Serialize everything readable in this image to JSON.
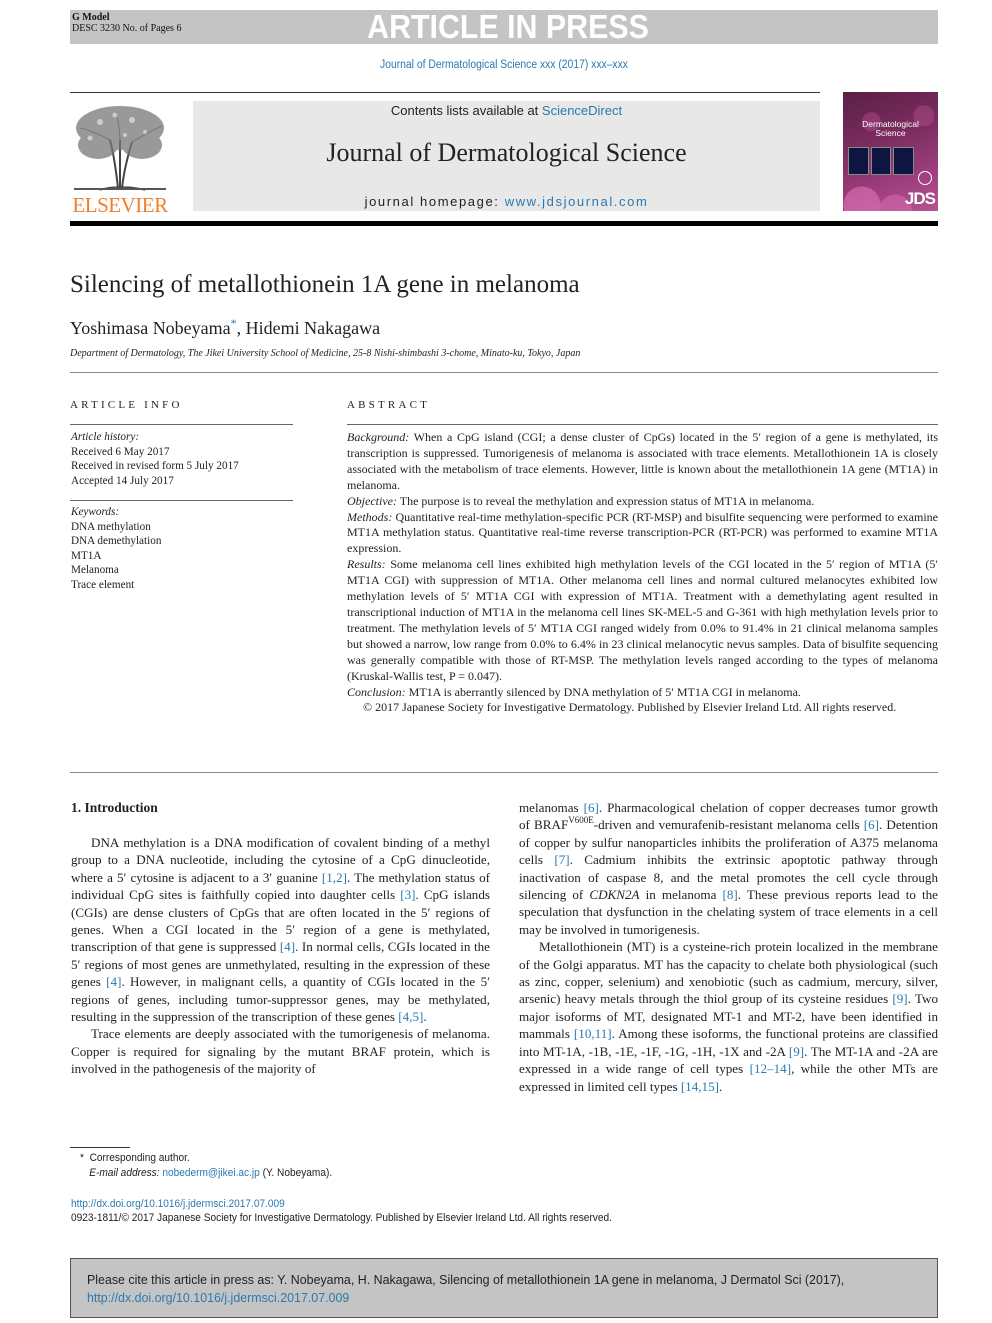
{
  "banner": {
    "g_model": "G Model",
    "doc_id": "DESC 3230 No. of Pages 6",
    "status": "ARTICLE IN PRESS",
    "journal_ref": "Journal of Dermatological Science xxx (2017) xxx–xxx"
  },
  "header": {
    "publisher": "ELSEVIER",
    "contents_prefix": "Contents lists available at ",
    "contents_link": "ScienceDirect",
    "journal_name": "Journal of Dermatological Science",
    "homepage_prefix": "journal homepage: ",
    "homepage_link": "www.jdsjournal.com",
    "cover_title_line1": "Dermatological",
    "cover_title_line2": "Science",
    "cover_badge": "JDS"
  },
  "article": {
    "title": "Silencing of metallothionein 1A gene in melanoma",
    "author1": "Yoshimasa Nobeyama",
    "author_marker": "*",
    "author_sep": ", ",
    "author2": "Hidemi Nakagawa",
    "affiliation": "Department of Dermatology, The Jikei University School of Medicine, 25-8 Nishi-shimbashi 3-chome, Minato-ku, Tokyo, Japan"
  },
  "article_info": {
    "heading": "ARTICLE INFO",
    "history_label": "Article history:",
    "history": [
      "Received 6 May 2017",
      "Received in revised form 5 July 2017",
      "Accepted 14 July 2017"
    ],
    "keywords_label": "Keywords:",
    "keywords": [
      "DNA methylation",
      "DNA demethylation",
      "MT1A",
      "Melanoma",
      "Trace element"
    ]
  },
  "abstract": {
    "heading": "ABSTRACT",
    "background_label": "Background:",
    "background_text": " When a CpG island (CGI; a dense cluster of CpGs) located in the 5′ region of a gene is methylated, its transcription is suppressed. Tumorigenesis of melanoma is associated with trace elements. Metallothionein 1A is closely associated with the metabolism of trace elements. However, little is known about the metallothionein 1A gene (MT1A) in melanoma.",
    "objective_label": "Objective:",
    "objective_text": " The purpose is to reveal the methylation and expression status of MT1A in melanoma.",
    "methods_label": "Methods:",
    "methods_text": " Quantitative real-time methylation-specific PCR (RT-MSP) and bisulfite sequencing were performed to examine MT1A methylation status. Quantitative real-time reverse transcription-PCR (RT-PCR) was performed to examine MT1A expression.",
    "results_label": "Results:",
    "results_text": " Some melanoma cell lines exhibited high methylation levels of the CGI located in the 5′ region of MT1A (5′ MT1A CGI) with suppression of MT1A. Other melanoma cell lines and normal cultured melanocytes exhibited low methylation levels of 5′ MT1A CGI with expression of MT1A. Treatment with a demethylating agent resulted in transcriptional induction of MT1A in the melanoma cell lines SK-MEL-5 and G-361 with high methylation levels prior to treatment. The methylation levels of 5′ MT1A CGI ranged widely from 0.0% to 91.4% in 21 clinical melanoma samples but showed a narrow, low range from 0.0% to 6.4% in 23 clinical melanocytic nevus samples. Data of bisulfite sequencing was generally compatible with those of RT-MSP. The methylation levels ranged according to the types of melanoma (Kruskal-Wallis test, P = 0.047).",
    "conclusion_label": "Conclusion:",
    "conclusion_text": " MT1A is aberrantly silenced by DNA methylation of 5′ MT1A CGI in melanoma.",
    "copyright": "© 2017 Japanese Society for Investigative Dermatology. Published by Elsevier Ireland Ltd. All rights reserved."
  },
  "body": {
    "section_heading": "1. Introduction",
    "left": {
      "p1_a": "DNA methylation is a DNA modification of covalent binding of a methyl group to a DNA nucleotide, including the cytosine of a CpG dinucleotide, where a 5′ cytosine is adjacent to a 3′ guanine ",
      "p1_ref1": "[1,2]",
      "p1_b": ". The methylation status of individual CpG sites is faithfully copied into daughter cells ",
      "p1_ref2": "[3]",
      "p1_c": ". CpG islands (CGIs) are dense clusters of CpGs that are often located in the 5′ regions of genes. When a CGI located in the 5′ region of a gene is methylated, transcription of that gene is suppressed ",
      "p1_ref3": "[4]",
      "p1_d": ". In normal cells, CGIs located in the 5′ regions of most genes are unmethylated, resulting in the expression of these genes ",
      "p1_ref4": "[4]",
      "p1_e": ". However, in malignant cells, a quantity of CGIs located in the 5′ regions of genes, including tumor-suppressor genes, may be methylated, resulting in the suppression of the transcription of these genes ",
      "p1_ref5": "[4,5]",
      "p1_f": ".",
      "p2": "Trace elements are deeply associated with the tumorigenesis of melanoma. Copper is required for signaling by the mutant BRAF protein, which is involved in the pathogenesis of the majority of"
    },
    "right": {
      "p2_a": "melanomas ",
      "p2_ref1": "[6]",
      "p2_b": ". Pharmacological chelation of copper decreases tumor growth of BRAF",
      "p2_sup": "V600E",
      "p2_c": "-driven and vemurafenib-resistant melanoma cells ",
      "p2_ref2": "[6]",
      "p2_d": ". Detention of copper by sulfur nanoparticles inhibits the proliferation of A375 melanoma cells ",
      "p2_ref3": "[7]",
      "p2_e": ". Cadmium inhibits the extrinsic apoptotic pathway through inactivation of caspase 8, and the metal promotes the cell cycle through silencing of ",
      "p2_gene": "CDKN2A",
      "p2_f": " in melanoma ",
      "p2_ref4": "[8]",
      "p2_g": ". These previous reports lead to the speculation that dysfunction in the chelating system of trace elements in a cell may be involved in tumorigenesis.",
      "p3_a": "Metallothionein (MT) is a cysteine-rich protein localized in the membrane of the Golgi apparatus. MT has the capacity to chelate both physiological (such as zinc, copper, selenium) and xenobiotic (such as cadmium, mercury, silver, arsenic) heavy metals through the thiol group of its cysteine residues ",
      "p3_ref1": "[9]",
      "p3_b": ". Two major isoforms of MT, designated MT-1 and MT-2, have been identified in mammals ",
      "p3_ref2": "[10,11]",
      "p3_c": ". Among these isoforms, the functional proteins are classified into MT-1A, -1B, -1E, -1F, -1G, -1H, -1X and -2A ",
      "p3_ref3": "[9]",
      "p3_d": ". The MT-1A and -2A are expressed in a wide range of cell types ",
      "p3_ref4": "[12–14]",
      "p3_e": ", while the other MTs are expressed in limited cell types ",
      "p3_ref5": "[14,15]",
      "p3_f": "."
    }
  },
  "footnotes": {
    "marker": "*",
    "corresponding": "Corresponding author.",
    "email_label": "E-mail address:",
    "email": "nobederm@jikei.ac.jp",
    "email_suffix": " (Y. Nobeyama).",
    "doi": "http://dx.doi.org/10.1016/j.jdermsci.2017.07.009",
    "issn_line": "0923-1811/© 2017 Japanese Society for Investigative Dermatology. Published by Elsevier Ireland Ltd. All rights reserved."
  },
  "cite_box": {
    "text": "Please cite this article in press as: Y. Nobeyama, H. Nakagawa, Silencing of metallothionein 1A gene in melanoma, J Dermatol Sci (2017), ",
    "link": "http://dx.doi.org/10.1016/j.jdermsci.2017.07.009"
  },
  "colors": {
    "link": "#2a7ab0",
    "elsevier_orange": "#f07f2c",
    "banner_gray": "#c4c4c4"
  }
}
